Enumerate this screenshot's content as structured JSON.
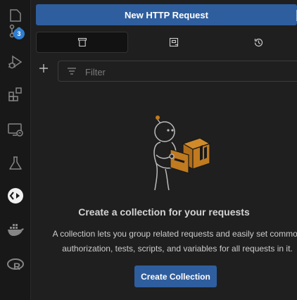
{
  "activity_bar": {
    "items": [
      {
        "icon": "explorer-icon"
      },
      {
        "icon": "source-control-icon",
        "badge": "3"
      },
      {
        "icon": "run-debug-icon"
      },
      {
        "icon": "extensions-icon"
      },
      {
        "icon": "remote-explorer-icon"
      },
      {
        "icon": "testing-icon"
      },
      {
        "icon": "http-client-icon",
        "active": true
      },
      {
        "icon": "docker-icon"
      },
      {
        "icon": "r-icon"
      }
    ]
  },
  "toolbar": {
    "new_request_label": "New HTTP Request"
  },
  "tabs": [
    {
      "icon": "trash-icon",
      "active": true
    },
    {
      "icon": "collection-icon",
      "active": false
    },
    {
      "icon": "history-icon",
      "active": false
    }
  ],
  "filter": {
    "placeholder": "Filter"
  },
  "empty_state": {
    "title": "Create a collection for your requests",
    "description_line1": "A collection lets you group related requests and easily set common",
    "description_line2": "authorization, tests, scripts, and variables for all requests in it.",
    "button_label": "Create Collection"
  },
  "colors": {
    "accent": "#2f5e9e",
    "badge": "#2f7fd1",
    "box": "#c07a1f",
    "background": "#1f1f1f"
  }
}
